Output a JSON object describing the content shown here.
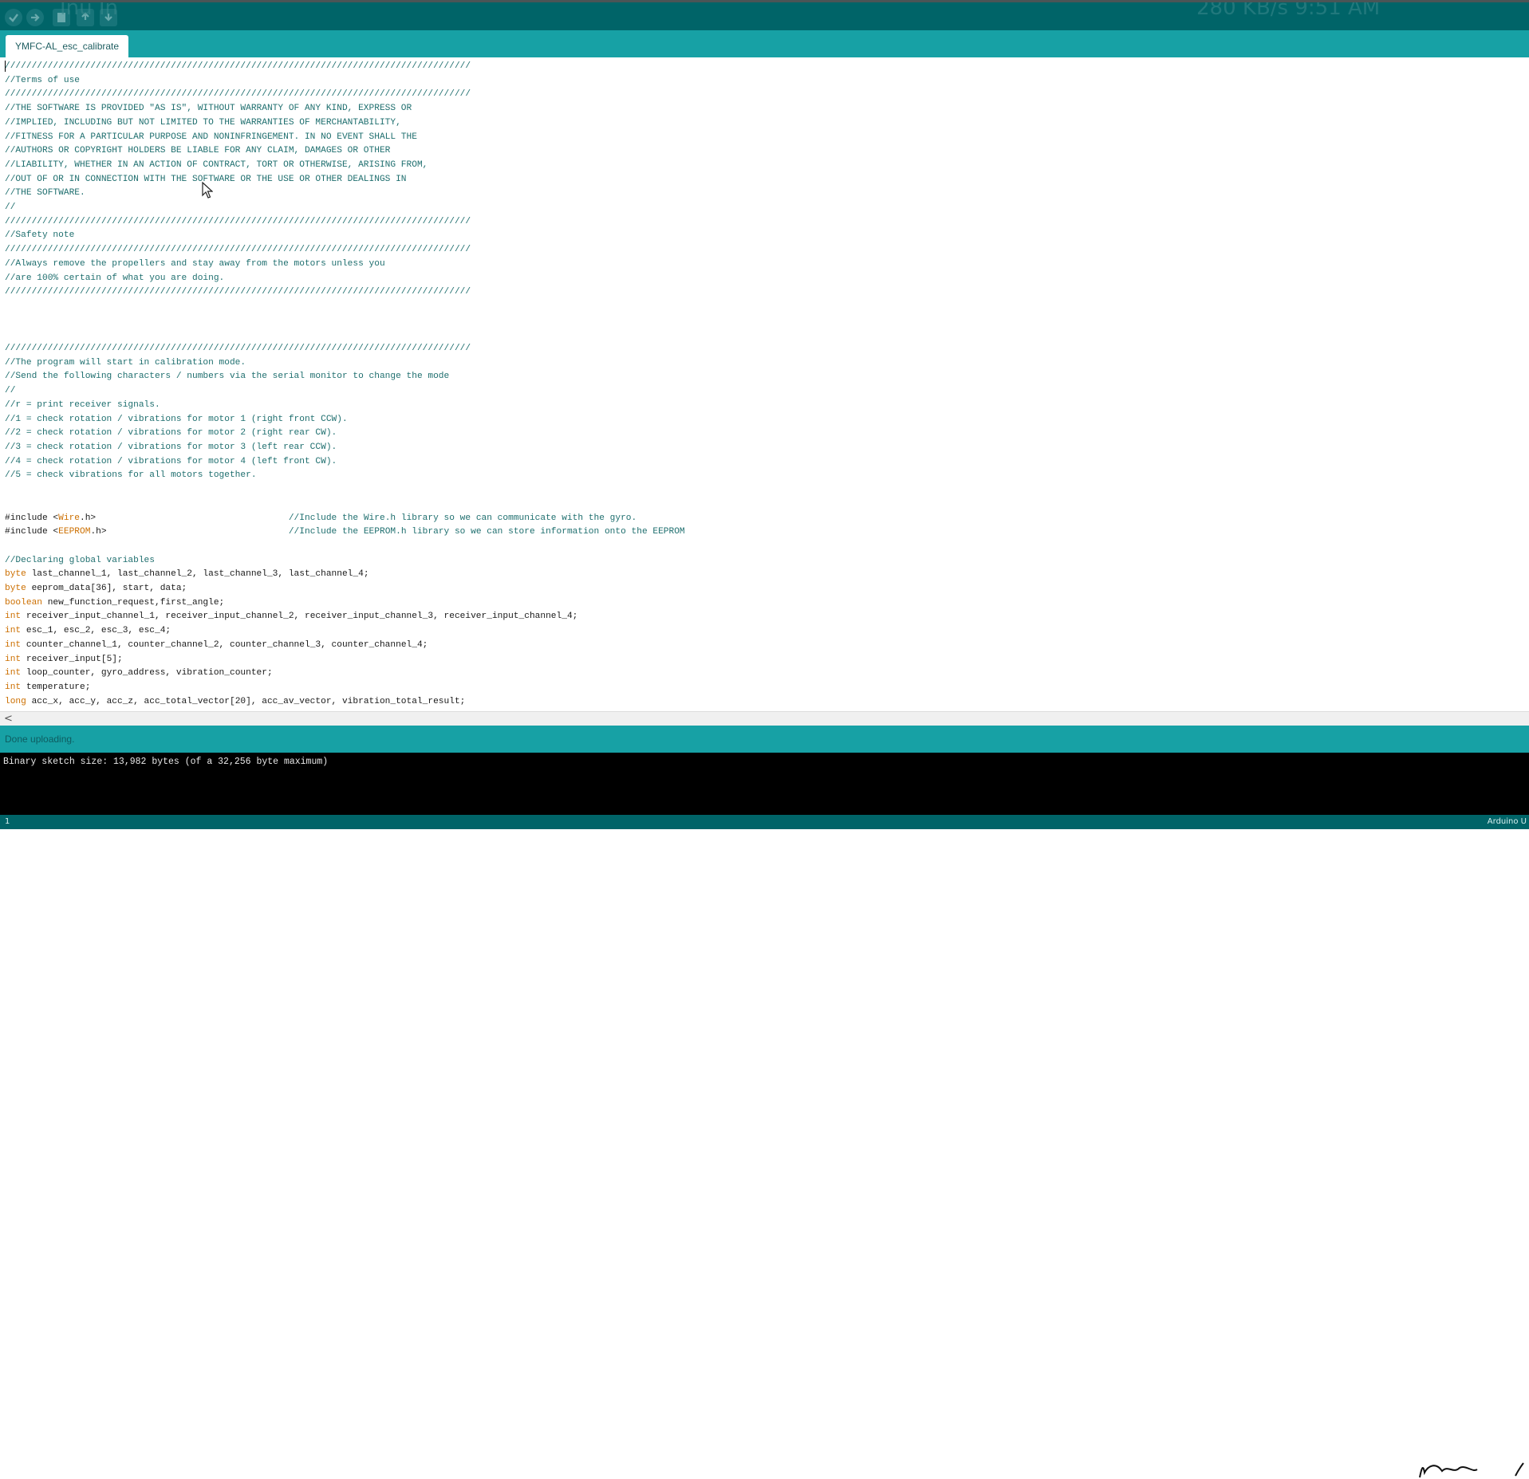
{
  "toolbar": {
    "buttons": [
      "verify-icon",
      "upload-icon",
      "new-icon",
      "open-icon",
      "save-icon"
    ],
    "ghost_left": "Inu In",
    "ghost_right": "280 KB/s     9:51 AM"
  },
  "tab": {
    "label": "YMFC-AL_esc_calibrate"
  },
  "status": {
    "text": "Done uploading."
  },
  "console": {
    "text": "Binary sketch size: 13,982 bytes (of a 32,256 byte maximum)"
  },
  "footer": {
    "line": "1",
    "board": "Arduino U"
  },
  "code": [
    "///////////////////////////////////////////////////////////////////////////////////////",
    "//Terms of use",
    "///////////////////////////////////////////////////////////////////////////////////////",
    "//THE SOFTWARE IS PROVIDED \"AS IS\", WITHOUT WARRANTY OF ANY KIND, EXPRESS OR",
    "//IMPLIED, INCLUDING BUT NOT LIMITED TO THE WARRANTIES OF MERCHANTABILITY,",
    "//FITNESS FOR A PARTICULAR PURPOSE AND NONINFRINGEMENT. IN NO EVENT SHALL THE",
    "//AUTHORS OR COPYRIGHT HOLDERS BE LIABLE FOR ANY CLAIM, DAMAGES OR OTHER",
    "//LIABILITY, WHETHER IN AN ACTION OF CONTRACT, TORT OR OTHERWISE, ARISING FROM,",
    "//OUT OF OR IN CONNECTION WITH THE SOFTWARE OR THE USE OR OTHER DEALINGS IN",
    "//THE SOFTWARE.",
    "//",
    "///////////////////////////////////////////////////////////////////////////////////////",
    "//Safety note",
    "///////////////////////////////////////////////////////////////////////////////////////",
    "//Always remove the propellers and stay away from the motors unless you",
    "//are 100% certain of what you are doing.",
    "///////////////////////////////////////////////////////////////////////////////////////",
    "",
    "",
    "",
    "///////////////////////////////////////////////////////////////////////////////////////",
    "//The program will start in calibration mode.",
    "//Send the following characters / numbers via the serial monitor to change the mode",
    "//",
    "//r = print receiver signals.",
    "//1 = check rotation / vibrations for motor 1 (right front CCW).",
    "//2 = check rotation / vibrations for motor 2 (right rear CW).",
    "//3 = check rotation / vibrations for motor 3 (left rear CCW).",
    "//4 = check rotation / vibrations for motor 4 (left front CW).",
    "//5 = check vibrations for all motors together.",
    "",
    "",
    "#include <Wire.h>                                    //Include the Wire.h library so we can communicate with the gyro.",
    "#include <EEPROM.h>                                  //Include the EEPROM.h library so we can store information onto the EEPROM",
    "",
    "//Declaring global variables",
    "byte last_channel_1, last_channel_2, last_channel_3, last_channel_4;",
    "byte eeprom_data[36], start, data;",
    "boolean new_function_request,first_angle;",
    "int receiver_input_channel_1, receiver_input_channel_2, receiver_input_channel_3, receiver_input_channel_4;",
    "int esc_1, esc_2, esc_3, esc_4;",
    "int counter_channel_1, counter_channel_2, counter_channel_3, counter_channel_4;",
    "int receiver_input[5];",
    "int loop_counter, gyro_address, vibration_counter;",
    "int temperature;",
    "long acc_x, acc_y, acc_z, acc_total_vector[20], acc_av_vector, vibration_total_result;"
  ]
}
